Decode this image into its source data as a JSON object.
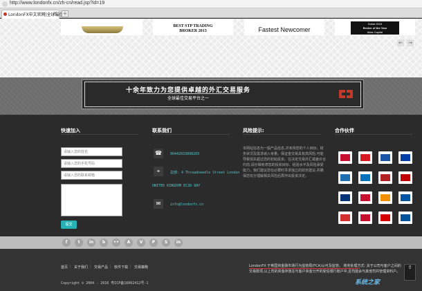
{
  "browser": {
    "url": "http://www.londonfx.cn/zh-cn/read.jsp?id=19",
    "tab_title": "LondonFX中文官网|全球最佳|",
    "tab_close": "×",
    "new_tab": "+"
  },
  "awards": {
    "award2_line1": "BEST STP TRADING",
    "award2_line2": "BROKER 2013",
    "award3": "Fastest Newcomer",
    "award4_line1": "Dubai 2015",
    "award4_line2": "Broker of the Year",
    "award4_line3": "Atlas Capital",
    "prev": "←",
    "next": "→"
  },
  "banner": {
    "title": "十余年致力为您提供卓越的外汇交易服务",
    "subtitle": "全球最佳交易平台之一"
  },
  "quick_join": {
    "title": "快速加入",
    "name_placeholder": "请输入您的姓名",
    "phone_placeholder": "请输入您的手机号码",
    "email_placeholder": "请输入您的联系邮箱",
    "submit": "提交"
  },
  "contact": {
    "title": "联系我们",
    "phone": "00442033898203",
    "address_line1": "总部: 4 Threadneedle Street London",
    "address_line2": "UNITED KINGDOM EC2R 8AY",
    "email": "info@londonfx.cn",
    "phone_icon": "☎",
    "location_icon": "⌖",
    "mail_icon": "✉"
  },
  "risk": {
    "title": "风险提示:",
    "text": "本网站信息为一般产品信息,并未将您的个人目标、财务状况及需求纳入考量。保证金交易具有高风险,可能导致损失超过您的初始投资。在决定交易外汇或差价合约前,请仔细考虑您的投资目标、经验水平及风险承受能力。我们建议您在必要时寻求独立的财务建议,并确保您充分理解相关风险后再作出投资决定。"
  },
  "partners": {
    "title": "合作伙伴",
    "logos": [
      "partner-logo-1",
      "partner-logo-2",
      "partner-logo-3",
      "partner-logo-4",
      "partner-logo-5",
      "partner-logo-6",
      "partner-logo-7",
      "partner-logo-8",
      "partner-logo-9",
      "partner-logo-10",
      "partner-logo-11",
      "partner-logo-12",
      "partner-logo-13",
      "partner-logo-14",
      "partner-logo-15",
      "partner-logo-16"
    ],
    "colors": [
      "#c8102e",
      "#d71920",
      "#1a56a6",
      "#003da5",
      "#1f6fb2",
      "#0072bc",
      "#b22222",
      "#c00000",
      "#003478",
      "#c8102e",
      "#f29100",
      "#0055a5",
      "#d32f2f",
      "#c8102e",
      "#d50000",
      "#00539b"
    ]
  },
  "social": {
    "icons": [
      "f",
      "t",
      "in",
      "b",
      "••",
      "A",
      "V",
      "P",
      "S",
      "in"
    ]
  },
  "bottom": {
    "nav": [
      "首页",
      "关于我们",
      "交易产品",
      "软件下载",
      "交易策略"
    ],
    "sep": "|",
    "copyright": "Copyright © 2004 - 2016 粤ICP备16002412号-1",
    "reg_text": "LondonFX 于英国资金融市场行为监管局(FCA)认可及监管。 账务处理方式: 关于公司与客户之间的交易款项,以上司的资金存放在与客户资金分开的受信银行账户中,且司能会与其他司共管理资料户。",
    "scroll_top": "⇧",
    "watermark": "系统之家"
  }
}
